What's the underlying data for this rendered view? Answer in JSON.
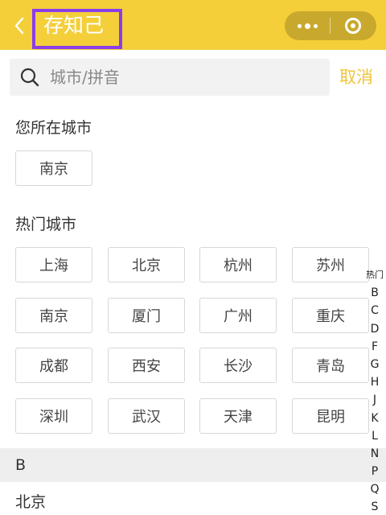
{
  "header": {
    "title": "存知己",
    "back_icon": "chevron-left-icon",
    "capsule_more_icon": "more-dots-icon",
    "capsule_close_icon": "target-circle-icon",
    "background_color": "#f4cf3a",
    "highlight_color": "#8a3de8"
  },
  "search": {
    "placeholder": "城市/拼音",
    "value": "",
    "icon": "search-icon",
    "cancel_label": "取消"
  },
  "current_city": {
    "label": "您所在城市",
    "city": "南京"
  },
  "hot_cities": {
    "label": "热门城市",
    "cities": [
      "上海",
      "北京",
      "杭州",
      "苏州",
      "南京",
      "厦门",
      "广州",
      "重庆",
      "成都",
      "西安",
      "长沙",
      "青岛",
      "深圳",
      "武汉",
      "天津",
      "昆明"
    ]
  },
  "groups": [
    {
      "letter": "B",
      "cities": [
        "北京"
      ]
    }
  ],
  "index_bar": [
    "热门",
    "B",
    "C",
    "D",
    "F",
    "G",
    "H",
    "J",
    "K",
    "L",
    "N",
    "P",
    "Q",
    "S"
  ]
}
